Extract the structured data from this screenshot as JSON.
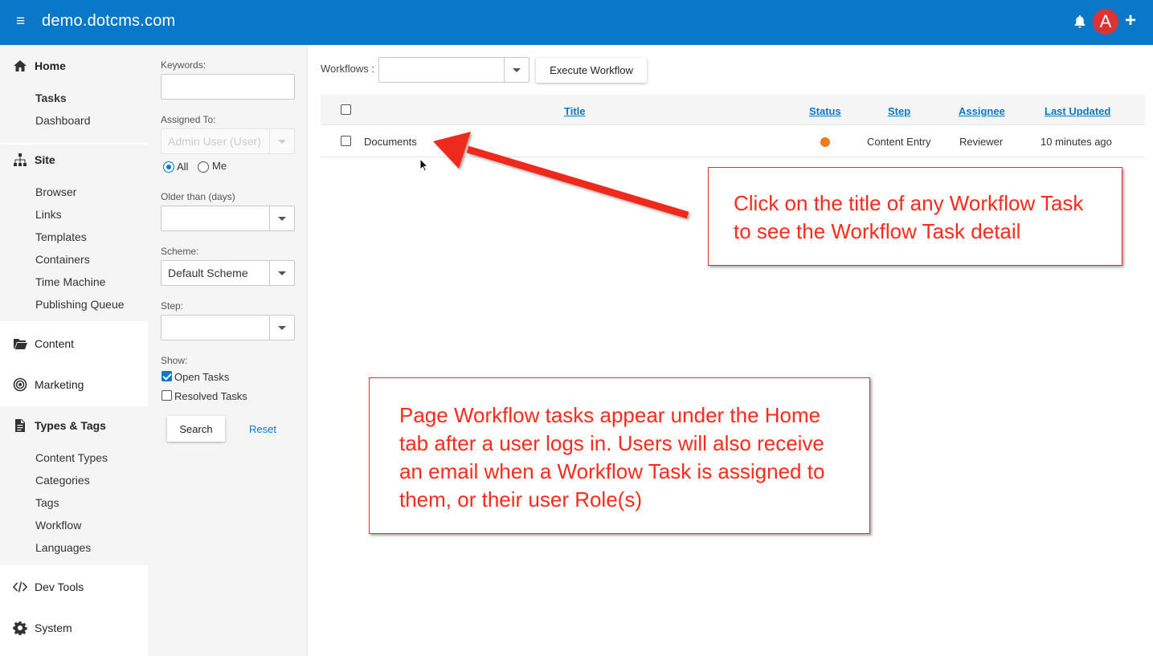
{
  "topbar": {
    "site_name": "demo.dotcms.com",
    "avatar_letter": "A",
    "accent_color": "#0a78c8",
    "icons": [
      "menu-icon",
      "bell-icon",
      "plus-icon"
    ]
  },
  "sidebar": {
    "home": {
      "label": "Home",
      "icon": "home-icon",
      "items": [
        "Tasks",
        "Dashboard"
      ],
      "active_item": "Tasks"
    },
    "site": {
      "label": "Site",
      "icon": "sitemap-icon",
      "items": [
        "Browser",
        "Links",
        "Templates",
        "Containers",
        "Time Machine",
        "Publishing Queue"
      ]
    },
    "content": {
      "label": "Content",
      "icon": "folder-icon"
    },
    "marketing": {
      "label": "Marketing",
      "icon": "target-icon"
    },
    "types_tags": {
      "label": "Types & Tags",
      "icon": "file-icon",
      "items": [
        "Content Types",
        "Categories",
        "Tags",
        "Workflow",
        "Languages"
      ]
    },
    "dev_tools": {
      "label": "Dev Tools",
      "icon": "code-icon"
    },
    "system": {
      "label": "System",
      "icon": "gear-icon"
    }
  },
  "filters": {
    "keywords_label": "Keywords:",
    "keywords_value": "",
    "assigned_label": "Assigned To:",
    "assigned_value": "Admin User (User)",
    "radio_all": "All",
    "radio_me": "Me",
    "radio_selected": "All",
    "older_label": "Older than (days)",
    "older_value": "",
    "scheme_label": "Scheme:",
    "scheme_value": "Default Scheme",
    "step_label": "Step:",
    "step_value": "",
    "show_label": "Show:",
    "open_tasks_label": "Open Tasks",
    "open_tasks_checked": true,
    "resolved_tasks_label": "Resolved Tasks",
    "resolved_tasks_checked": false,
    "search_button": "Search",
    "reset_link": "Reset"
  },
  "main": {
    "workflows_label": "Workflows :",
    "workflows_value": "",
    "execute_button": "Execute Workflow",
    "columns": [
      "Title",
      "Status",
      "Step",
      "Assignee",
      "Last Updated"
    ],
    "rows": [
      {
        "title": "Documents",
        "status_color": "#f07a20",
        "step": "Content Entry",
        "assignee": "Reviewer",
        "last_updated": "10 minutes ago"
      }
    ]
  },
  "callouts": {
    "top": "Click on the title of any Workflow Task to see the Workflow Task detail",
    "bottom": "Page Workflow tasks appear under the Home tab after a user logs in.  Users will also receive an email when a Workflow Task is assigned to them, or their user Role(s)",
    "color": "#ff2a1a"
  }
}
